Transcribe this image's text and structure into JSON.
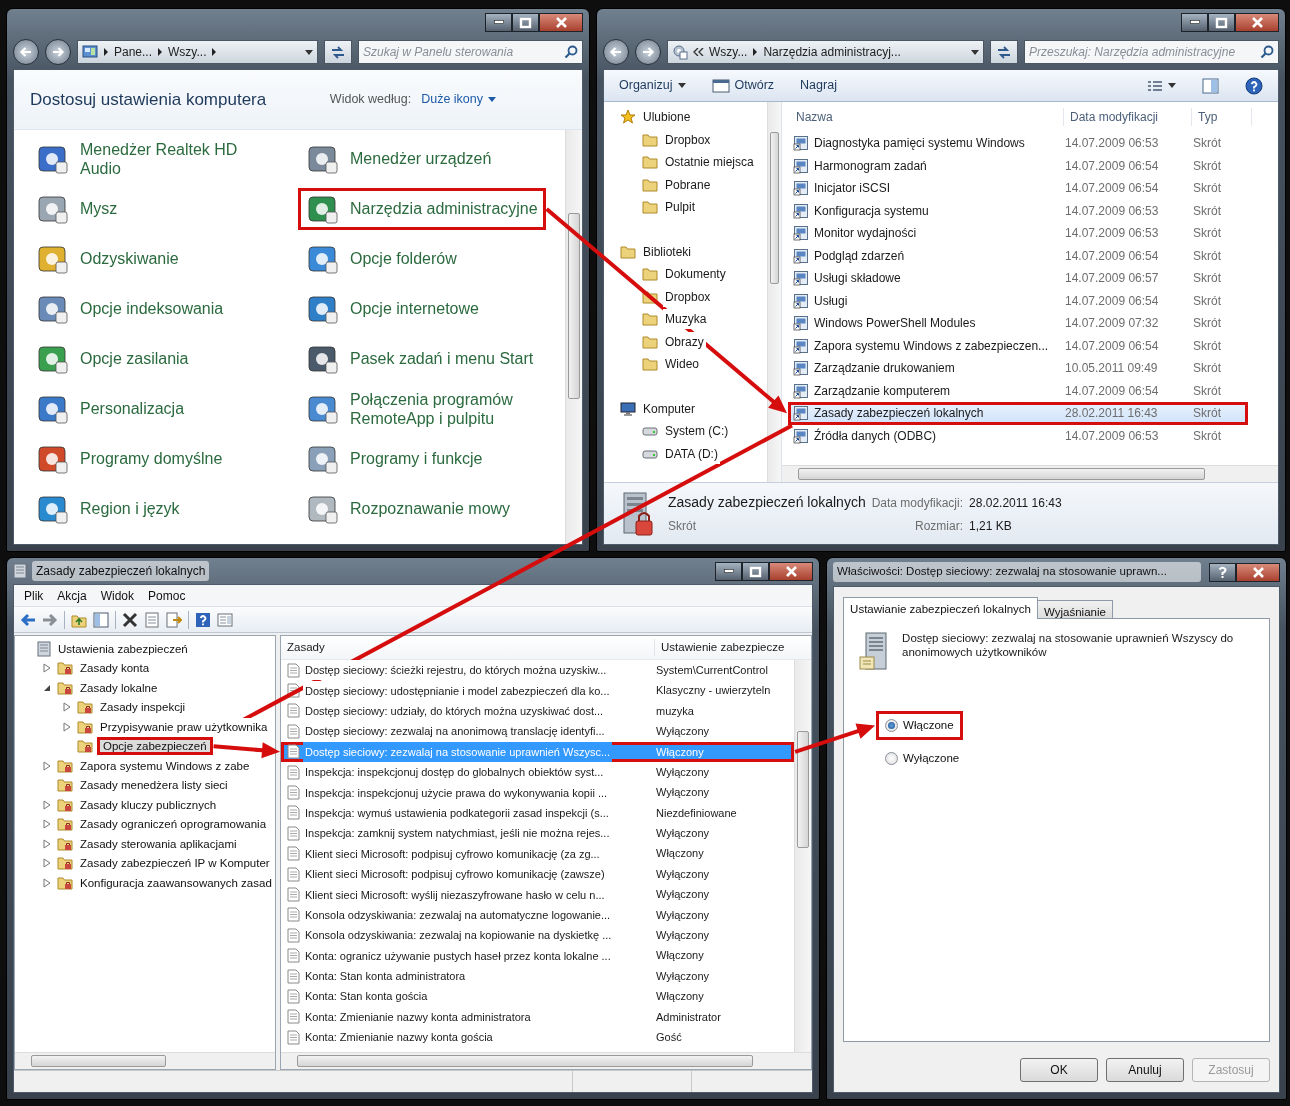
{
  "control_panel": {
    "address": [
      "Pane...",
      "Wszy..."
    ],
    "search": {
      "placeholder": "Szukaj w Panelu sterowania"
    },
    "heading": "Dostosuj ustawienia komputera",
    "view_label": "Widok według:",
    "view_value": "Duże ikony",
    "items": [
      {
        "label": "Menedżer Realtek HD Audio",
        "highlighted": false
      },
      {
        "label": "Menedżer urządzeń",
        "highlighted": false
      },
      {
        "label": "Mysz",
        "highlighted": false
      },
      {
        "label": "Narzędzia administracyjne",
        "highlighted": true
      },
      {
        "label": "Odzyskiwanie",
        "highlighted": false
      },
      {
        "label": "Opcje folderów",
        "highlighted": false
      },
      {
        "label": "Opcje indeksowania",
        "highlighted": false
      },
      {
        "label": "Opcje internetowe",
        "highlighted": false
      },
      {
        "label": "Opcje zasilania",
        "highlighted": false
      },
      {
        "label": "Pasek zadań i menu Start",
        "highlighted": false
      },
      {
        "label": "Personalizacja",
        "highlighted": false
      },
      {
        "label": "Połączenia programów RemoteApp i pulpitu",
        "highlighted": false
      },
      {
        "label": "Programy domyślne",
        "highlighted": false
      },
      {
        "label": "Programy i funkcje",
        "highlighted": false
      },
      {
        "label": "Region i język",
        "highlighted": false
      },
      {
        "label": "Rozpoznawanie mowy",
        "highlighted": false
      }
    ]
  },
  "explorer": {
    "address": [
      "Wszy...",
      "Narzędzia administracyj..."
    ],
    "search": {
      "placeholder": "Przeszukaj: Narzędzia administracyjne"
    },
    "toolbar": [
      {
        "label": "Organizuj",
        "kind": "menu"
      },
      {
        "label": "Otwórz",
        "kind": "open"
      },
      {
        "label": "Nagraj",
        "kind": "plain"
      }
    ],
    "nav": [
      {
        "label": "Ulubione",
        "kind": "favorites",
        "children": [
          "Dropbox",
          "Ostatnie miejsca",
          "Pobrane",
          "Pulpit"
        ]
      },
      {
        "label": "Biblioteki",
        "kind": "libraries",
        "children": [
          "Dokumenty",
          "Dropbox",
          "Muzyka",
          "Obrazy",
          "Wideo"
        ]
      },
      {
        "label": "Komputer",
        "kind": "computer",
        "children": [
          "System (C:)",
          "DATA (D:)"
        ]
      }
    ],
    "columns": [
      "Nazwa",
      "Data modyfikacji",
      "Typ"
    ],
    "rows": [
      {
        "name": "Diagnostyka pamięci systemu Windows",
        "date": "14.07.2009 06:53",
        "type": "Skrót",
        "selected": false,
        "highlighted": false
      },
      {
        "name": "Harmonogram zadań",
        "date": "14.07.2009 06:54",
        "type": "Skrót",
        "selected": false,
        "highlighted": false
      },
      {
        "name": "Inicjator iSCSI",
        "date": "14.07.2009 06:54",
        "type": "Skrót",
        "selected": false,
        "highlighted": false
      },
      {
        "name": "Konfiguracja systemu",
        "date": "14.07.2009 06:53",
        "type": "Skrót",
        "selected": false,
        "highlighted": false
      },
      {
        "name": "Monitor wydajności",
        "date": "14.07.2009 06:53",
        "type": "Skrót",
        "selected": false,
        "highlighted": false
      },
      {
        "name": "Podgląd zdarzeń",
        "date": "14.07.2009 06:54",
        "type": "Skrót",
        "selected": false,
        "highlighted": false
      },
      {
        "name": "Usługi składowe",
        "date": "14.07.2009 06:57",
        "type": "Skrót",
        "selected": false,
        "highlighted": false
      },
      {
        "name": "Usługi",
        "date": "14.07.2009 06:54",
        "type": "Skrót",
        "selected": false,
        "highlighted": false
      },
      {
        "name": "Windows PowerShell Modules",
        "date": "14.07.2009 07:32",
        "type": "Skrót",
        "selected": false,
        "highlighted": false
      },
      {
        "name": "Zapora systemu Windows z zabezpieczen...",
        "date": "14.07.2009 06:54",
        "type": "Skrót",
        "selected": false,
        "highlighted": false
      },
      {
        "name": "Zarządzanie drukowaniem",
        "date": "10.05.2011 09:49",
        "type": "Skrót",
        "selected": false,
        "highlighted": false
      },
      {
        "name": "Zarządzanie komputerem",
        "date": "14.07.2009 06:54",
        "type": "Skrót",
        "selected": false,
        "highlighted": false
      },
      {
        "name": "Zasady zabezpieczeń lokalnych",
        "date": "28.02.2011 16:43",
        "type": "Skrót",
        "selected": true,
        "highlighted": true
      },
      {
        "name": "Źródła danych (ODBC)",
        "date": "14.07.2009 06:53",
        "type": "Skrót",
        "selected": false,
        "highlighted": false
      }
    ],
    "details": {
      "name": "Zasady zabezpieczeń lokalnych",
      "date_label": "Data modyfikacji:",
      "date": "28.02.2011 16:43",
      "type": "Skrót",
      "size_label": "Rozmiar:",
      "size": "1,21 KB"
    }
  },
  "mmc": {
    "title": "Zasady zabezpieczeń lokalnych",
    "menu": [
      "Plik",
      "Akcja",
      "Widok",
      "Pomoc"
    ],
    "tree": [
      {
        "label": "Ustawienia zabezpieczeń",
        "selected": false,
        "highlighted": false,
        "children": [
          {
            "label": "Zasady konta",
            "expanded": false,
            "selected": false,
            "highlighted": false
          },
          {
            "label": "Zasady lokalne",
            "expanded": true,
            "selected": false,
            "highlighted": false,
            "children": [
              {
                "label": "Zasady inspekcji",
                "expanded": false,
                "selected": false,
                "highlighted": false
              },
              {
                "label": "Przypisywanie praw użytkownika",
                "expanded": false,
                "selected": false,
                "highlighted": false
              },
              {
                "label": "Opcje zabezpieczeń",
                "selected": true,
                "highlighted": true
              }
            ]
          },
          {
            "label": "Zapora systemu Windows z zabe",
            "expanded": false,
            "selected": false,
            "highlighted": false
          },
          {
            "label": "Zasady menedżera listy sieci",
            "selected": false,
            "highlighted": false
          },
          {
            "label": "Zasady kluczy publicznych",
            "expanded": false,
            "selected": false,
            "highlighted": false
          },
          {
            "label": "Zasady ograniczeń oprogramowania",
            "expanded": false,
            "selected": false,
            "highlighted": false
          },
          {
            "label": "Zasady sterowania aplikacjami",
            "expanded": false,
            "selected": false,
            "highlighted": false
          },
          {
            "label": "Zasady zabezpieczeń IP w Komputer",
            "expanded": false,
            "selected": false,
            "highlighted": false
          },
          {
            "label": "Konfiguracja zaawansowanych zasad",
            "expanded": false,
            "selected": false,
            "highlighted": false
          }
        ]
      }
    ],
    "columns": [
      "Zasady",
      "Ustawienie zabezpiecze"
    ],
    "rows": [
      {
        "policy": "Dostęp sieciowy: ścieżki rejestru, do których można uzyskiw...",
        "setting": "System\\CurrentControl",
        "selected": false,
        "highlighted": false
      },
      {
        "policy": "Dostęp sieciowy: udostępnianie i model zabezpieczeń dla ko...",
        "setting": "Klasyczny - uwierzyteln",
        "selected": false,
        "highlighted": false
      },
      {
        "policy": "Dostęp sieciowy: udziały, do których można uzyskiwać dost...",
        "setting": "muzyka",
        "selected": false,
        "highlighted": false
      },
      {
        "policy": "Dostęp sieciowy: zezwalaj na anonimową translację identyfi...",
        "setting": "Wyłączony",
        "selected": false,
        "highlighted": false
      },
      {
        "policy": "Dostęp sieciowy: zezwalaj na stosowanie uprawnień Wszysc...",
        "setting": "Włączony",
        "selected": true,
        "highlighted": true
      },
      {
        "policy": "Inspekcja: inspekcjonuj dostęp do globalnych obiektów syst...",
        "setting": "Wyłączony",
        "selected": false,
        "highlighted": false
      },
      {
        "policy": "Inspekcja: inspekcjonuj użycie prawa do wykonywania kopii ...",
        "setting": "Wyłączony",
        "selected": false,
        "highlighted": false
      },
      {
        "policy": "Inspekcja: wymuś ustawienia podkategorii zasad inspekcji (s...",
        "setting": "Niezdefiniowane",
        "selected": false,
        "highlighted": false
      },
      {
        "policy": "Inspekcja: zamknij system natychmiast, jeśli nie można rejes...",
        "setting": "Wyłączony",
        "selected": false,
        "highlighted": false
      },
      {
        "policy": "Klient sieci Microsoft: podpisuj cyfrowo komunikację (za zg...",
        "setting": "Włączony",
        "selected": false,
        "highlighted": false
      },
      {
        "policy": "Klient sieci Microsoft: podpisuj cyfrowo komunikację (zawsze)",
        "setting": "Wyłączony",
        "selected": false,
        "highlighted": false
      },
      {
        "policy": "Klient sieci Microsoft: wyślij niezaszyfrowane hasło w celu n...",
        "setting": "Wyłączony",
        "selected": false,
        "highlighted": false
      },
      {
        "policy": "Konsola odzyskiwania: zezwalaj na automatyczne logowanie...",
        "setting": "Wyłączony",
        "selected": false,
        "highlighted": false
      },
      {
        "policy": "Konsola odzyskiwania: zezwalaj na kopiowanie na dyskietkę ...",
        "setting": "Wyłączony",
        "selected": false,
        "highlighted": false
      },
      {
        "policy": "Konta: ogranicz używanie pustych haseł przez konta lokalne ...",
        "setting": "Włączony",
        "selected": false,
        "highlighted": false
      },
      {
        "policy": "Konta: Stan konta administratora",
        "setting": "Wyłączony",
        "selected": false,
        "highlighted": false
      },
      {
        "policy": "Konta: Stan konta gościa",
        "setting": "Włączony",
        "selected": false,
        "highlighted": false
      },
      {
        "policy": "Konta: Zmienianie nazwy konta administratora",
        "setting": "Administrator",
        "selected": false,
        "highlighted": false
      },
      {
        "policy": "Konta: Zmienianie nazwy konta gościa",
        "setting": "Gość",
        "selected": false,
        "highlighted": false
      }
    ]
  },
  "dialog": {
    "title": "Właściwości: Dostęp sieciowy: zezwalaj na stosowanie uprawn...",
    "tabs": [
      {
        "label": "Ustawianie zabezpieczeń lokalnych",
        "selected": true
      },
      {
        "label": "Wyjaśnianie",
        "selected": false
      }
    ],
    "description": "Dostęp sieciowy: zezwalaj na stosowanie uprawnień Wszyscy do anonimowych użytkowników",
    "options": [
      {
        "label": "Włączone",
        "selected": true,
        "highlighted": true
      },
      {
        "label": "Wyłączone",
        "selected": false,
        "highlighted": false
      }
    ],
    "buttons": [
      {
        "label": "OK",
        "disabled": false
      },
      {
        "label": "Anuluj",
        "disabled": false
      },
      {
        "label": "Zastosuj",
        "disabled": true
      }
    ]
  }
}
